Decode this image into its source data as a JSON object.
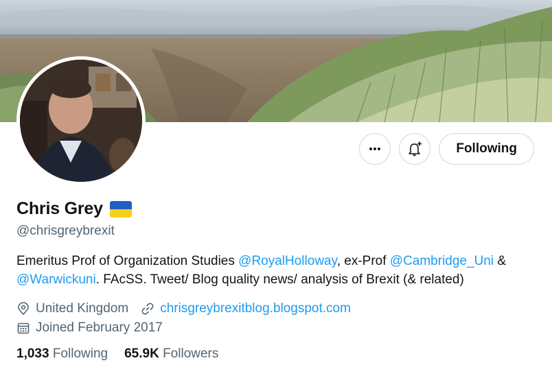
{
  "profile": {
    "name": "Chris Grey",
    "handle": "@chrisgreybrexit",
    "flag_colors": {
      "top": "#1f5fc4",
      "bottom": "#f7d117"
    },
    "bio": {
      "part1": "Emeritus Prof of Organization Studies ",
      "mention1": "@RoyalHolloway",
      "part2": ", ex-Prof ",
      "mention2": "@Cambridge_Uni",
      "part3": " & ",
      "mention3": "@Warwickuni",
      "part4": ". FAcSS. Tweet/ Blog quality news/ analysis of Brexit (& related)"
    },
    "location": "United Kingdom",
    "website": "chrisgreybrexitblog.blogspot.com",
    "joined": "Joined February 2017"
  },
  "actions": {
    "more_icon": "more-horizontal-icon",
    "notify_icon": "bell-plus-icon",
    "follow_label": "Following"
  },
  "stats": {
    "following_count": "1,033",
    "following_label": "Following",
    "followers_count": "65.9K",
    "followers_label": "Followers"
  },
  "colors": {
    "accent": "#1d9bf0",
    "secondary_text": "#536471",
    "primary_text": "#0f1419",
    "border": "#cfd9de"
  }
}
